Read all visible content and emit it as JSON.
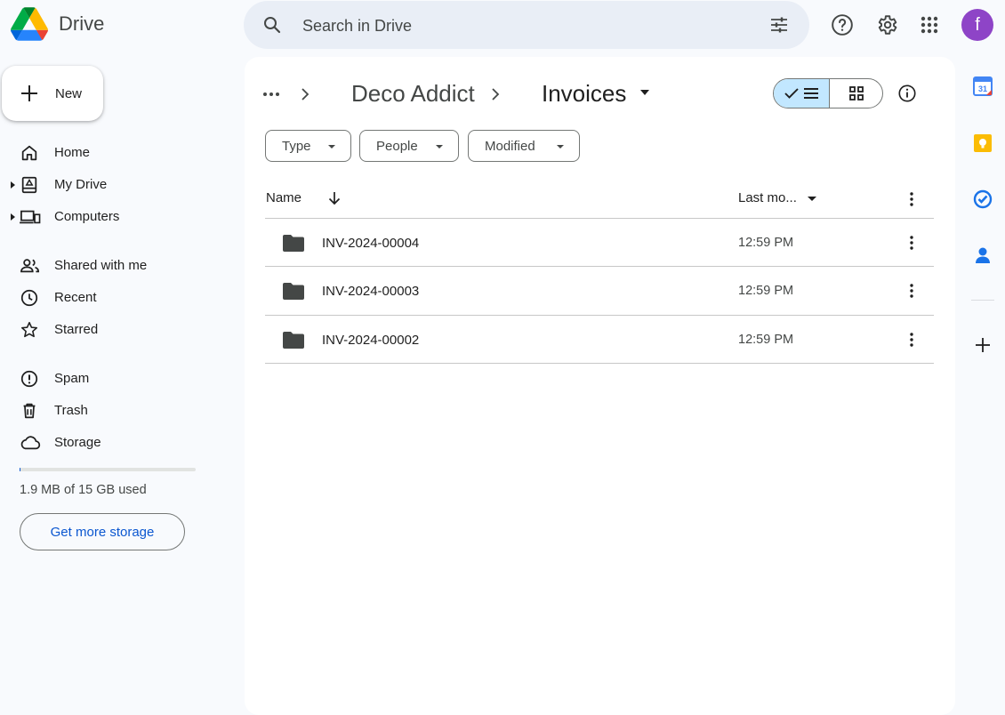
{
  "app": {
    "name": "Drive",
    "colors": {
      "accent": "#0b57d0",
      "selected_view": "#c2e7ff",
      "avatar": "#8e44c7"
    }
  },
  "header": {
    "search_placeholder": "Search in Drive",
    "avatar_letter": "f"
  },
  "sidebar": {
    "new_label": "New",
    "items": [
      {
        "label": "Home",
        "icon": "home-icon"
      },
      {
        "label": "My Drive",
        "icon": "my-drive-icon"
      },
      {
        "label": "Computers",
        "icon": "computers-icon"
      },
      {
        "label": "Shared with me",
        "icon": "shared-icon"
      },
      {
        "label": "Recent",
        "icon": "clock-icon"
      },
      {
        "label": "Starred",
        "icon": "star-icon"
      },
      {
        "label": "Spam",
        "icon": "spam-icon"
      },
      {
        "label": "Trash",
        "icon": "trash-icon"
      },
      {
        "label": "Storage",
        "icon": "cloud-icon"
      }
    ],
    "storage": {
      "used_text": "1.9 MB of 15 GB used",
      "used_fraction": 0.0001,
      "button": "Get more storage"
    }
  },
  "breadcrumb": {
    "items": [
      "Deco Addict",
      "Invoices"
    ]
  },
  "filters": [
    "Type",
    "People",
    "Modified"
  ],
  "table": {
    "columns": {
      "name": "Name",
      "modified": "Last mo..."
    },
    "rows": [
      {
        "name": "INV-2024-00004",
        "modified": "12:59 PM"
      },
      {
        "name": "INV-2024-00003",
        "modified": "12:59 PM"
      },
      {
        "name": "INV-2024-00002",
        "modified": "12:59 PM"
      }
    ]
  },
  "right_rail": [
    "calendar-icon",
    "keep-icon",
    "tasks-icon",
    "contacts-icon",
    "add-icon"
  ]
}
